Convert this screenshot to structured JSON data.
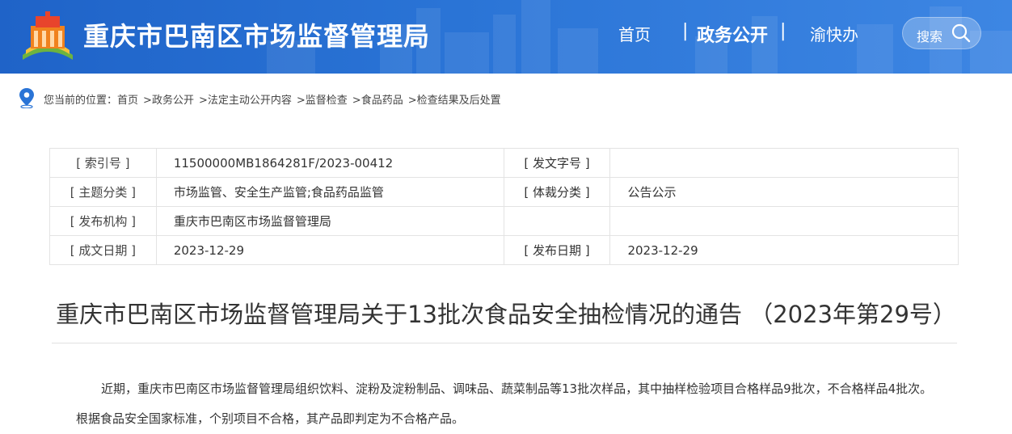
{
  "header": {
    "site_title": "重庆市巴南区市场监督管理局",
    "nav": {
      "home": "首页",
      "separator": "|",
      "gov_affairs": "政务公开",
      "yukuaiban": "渝快办"
    },
    "search_label": "搜索",
    "colors": {
      "header_bg": "#2a74d6",
      "logo_orange": "#f0821e",
      "logo_red": "#e8442c",
      "logo_green": "#6db33f"
    }
  },
  "breadcrumb": {
    "prefix": "您当前的位置：",
    "items": [
      "首页",
      "政务公开",
      "法定主动公开内容",
      "监督检查",
      "食品药品",
      "检查结果及后处置"
    ],
    "separator": ">",
    "icon": "location-pin-icon"
  },
  "meta": {
    "rows": [
      {
        "label1": "[ 索引号 ]",
        "value1": "11500000MB1864281F/2023-00412",
        "label2": "[ 发文字号 ]",
        "value2": ""
      },
      {
        "label1": "[ 主题分类 ]",
        "value1": "市场监管、安全生产监管;食品药品监管",
        "label2": "[ 体裁分类 ]",
        "value2": "公告公示"
      },
      {
        "label1": "[ 发布机构 ]",
        "value1": "重庆市巴南区市场监督管理局",
        "label2": "",
        "value2": ""
      },
      {
        "label1": "[ 成文日期 ]",
        "value1": "2023-12-29",
        "label2": "[ 发布日期 ]",
        "value2": "2023-12-29"
      }
    ]
  },
  "article": {
    "title": "重庆市巴南区市场监督管理局关于13批次食品安全抽检情况的通告 （2023年第29号）",
    "paragraph": "近期，重庆市巴南区市场监督管理局组织饮料、淀粉及淀粉制品、调味品、蔬菜制品等13批次样品，其中抽样检验项目合格样品9批次，不合格样品4批次。根据食品安全国家标准，个别项目不合格，其产品即判定为不合格产品。"
  }
}
